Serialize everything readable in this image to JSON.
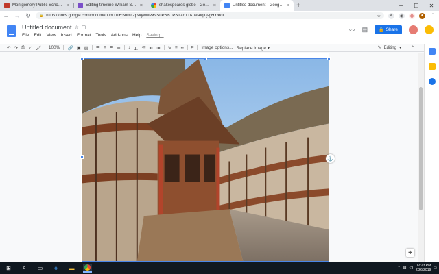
{
  "browser": {
    "tabs": [
      {
        "title": "Montgomery Public Schools - St",
        "icon": "school-icon",
        "color": "#c0392b",
        "active": false
      },
      {
        "title": "Editing timeline William Shakesp",
        "icon": "timeline-icon",
        "color": "#7b4fc9",
        "active": false
      },
      {
        "title": "shakespeares globe - Google Se",
        "icon": "google-icon",
        "color": "#4285f4",
        "active": false
      },
      {
        "title": "Untitled document - Google Doc",
        "icon": "docs-icon",
        "color": "#4285f4",
        "active": true
      }
    ],
    "close_glyph": "×",
    "new_tab_glyph": "+",
    "window_controls": [
      "─",
      "☐",
      "✕"
    ],
    "address": "https://docs.google.com/document/d/1lTRSnk0t2pWywwPXvSuP5i6TPSTZq1TK09AfqiQ-gHY/edit",
    "lock_glyph": "🔒",
    "star_glyph": "☆"
  },
  "doc": {
    "title": "Untitled document",
    "title_icons": [
      "☆",
      "▢"
    ],
    "menu": [
      "File",
      "Edit",
      "View",
      "Insert",
      "Format",
      "Tools",
      "Add-ons",
      "Help"
    ],
    "saving": "Saving...",
    "share_label": "Share",
    "share_icon": "lock-icon"
  },
  "toolbar": {
    "zoom": "100%",
    "image_options": "Image options...",
    "replace_image": "Replace image ▾",
    "mode": "Editing",
    "mode_caret": "▾",
    "collapse": "⌃"
  },
  "taskbar": {
    "time": "12:23 PM",
    "date": "2/26/2019"
  },
  "colors": {
    "accent": "#1a73e8",
    "docs_blue": "#4285f4",
    "selection": "#4a86e8",
    "taskbar": "#101820"
  }
}
